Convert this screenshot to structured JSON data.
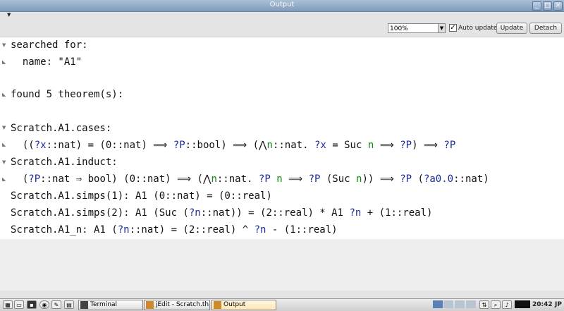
{
  "window": {
    "title": "Output"
  },
  "toolbar": {
    "zoom": "100%",
    "auto_update_label": "Auto update",
    "auto_update_checked": true,
    "update_label": "Update",
    "detach_label": "Detach"
  },
  "output": {
    "line1": "searched for:",
    "line2": "  name: \"A1\"",
    "line3": "found 5 theorem(s):",
    "t1_name": "Scratch.A1.cases:",
    "t2_name": "Scratch.A1.induct:",
    "t3": "Scratch.A1.simps(1): A1 (0::nat) = (0::real)",
    "t4a": "Scratch.A1.simps(2): A1 (Suc (",
    "t4v1": "?n",
    "t4b": "::nat)) = (2::real) * A1 ",
    "t4v2": "?n",
    "t4c": " + (1::real)",
    "t5a": "Scratch.A1_n: A1 (",
    "t5v1": "?n",
    "t5b": "::nat) = (2::real) ^ ",
    "t5v2": "?n",
    "t5c": " - (1::real)"
  },
  "taskbar": {
    "terminal": "Terminal",
    "jedit": "jEdit - Scratch.th…",
    "output": "Output",
    "clock": "20:42",
    "keyboard": "JP"
  }
}
